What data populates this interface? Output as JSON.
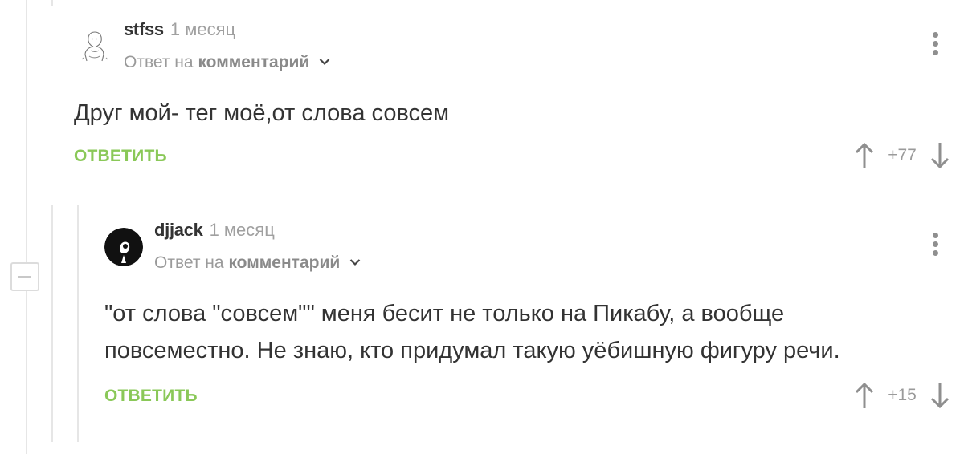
{
  "comments": [
    {
      "username": "stfss",
      "time": "1 месяц",
      "reply_prefix": "Ответ на",
      "reply_target": "комментарий",
      "text_lines": [
        "Друг мой- тег моё,от слова совсем"
      ],
      "reply_label": "ОТВЕТИТЬ",
      "rating": "+77"
    },
    {
      "username": "djjack",
      "time": "1 месяц",
      "reply_prefix": "Ответ на",
      "reply_target": "комментарий",
      "text_lines": [
        "\"от слова \"совсем\"\" меня бесит не только на Пикабу, а вообще",
        "повсеместно. Не знаю, кто придумал такую уёбишную фигуру речи."
      ],
      "reply_label": "ОТВЕТИТЬ",
      "rating": "+15"
    }
  ],
  "icons": {
    "upvote": "arrow-up-icon",
    "downvote": "arrow-down-icon",
    "menu": "more-vertical-icon",
    "expand": "chevron-down-icon",
    "collapse": "minus-icon"
  },
  "colors": {
    "accent_green": "#8ac858",
    "text": "#333333",
    "muted": "#9a9a9a"
  }
}
